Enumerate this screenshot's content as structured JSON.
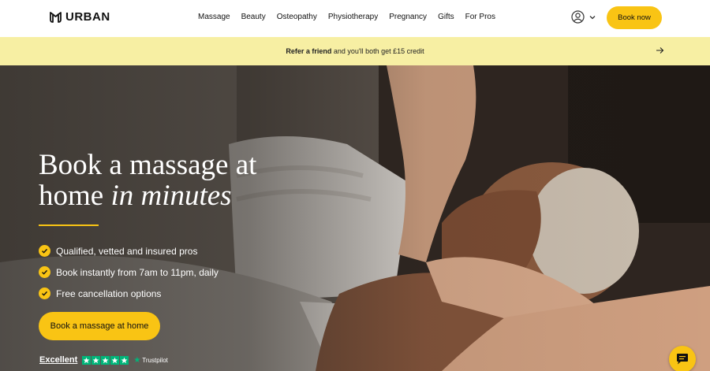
{
  "header": {
    "logo_text": "URBAN",
    "nav": [
      "Massage",
      "Beauty",
      "Osteopathy",
      "Physiotherapy",
      "Pregnancy",
      "Gifts",
      "For Pros"
    ],
    "book_now_label": "Book now"
  },
  "banner": {
    "bold_text": "Refer a friend",
    "rest_text": " and you'll both get £15 credit"
  },
  "hero": {
    "title_line1": "Book a massage at",
    "title_line2_plain": "home ",
    "title_line2_italic": "in minutes",
    "features": [
      "Qualified, vetted and insured pros",
      "Book instantly from 7am to 11pm, daily",
      "Free cancellation options"
    ],
    "cta_label": "Book a massage at home"
  },
  "trust": {
    "rating_label": "Excellent",
    "provider": "Trustpilot",
    "stars": 5
  },
  "colors": {
    "accent": "#f9c414",
    "banner": "#f7efa3",
    "trustpilot_green": "#00b67a"
  },
  "icons": {
    "logo": "urban-logo-icon",
    "account": "user-circle-icon",
    "account_dropdown": "chevron-down-icon",
    "banner_arrow": "arrow-right-icon",
    "check": "check-icon",
    "chat": "chat-icon"
  }
}
